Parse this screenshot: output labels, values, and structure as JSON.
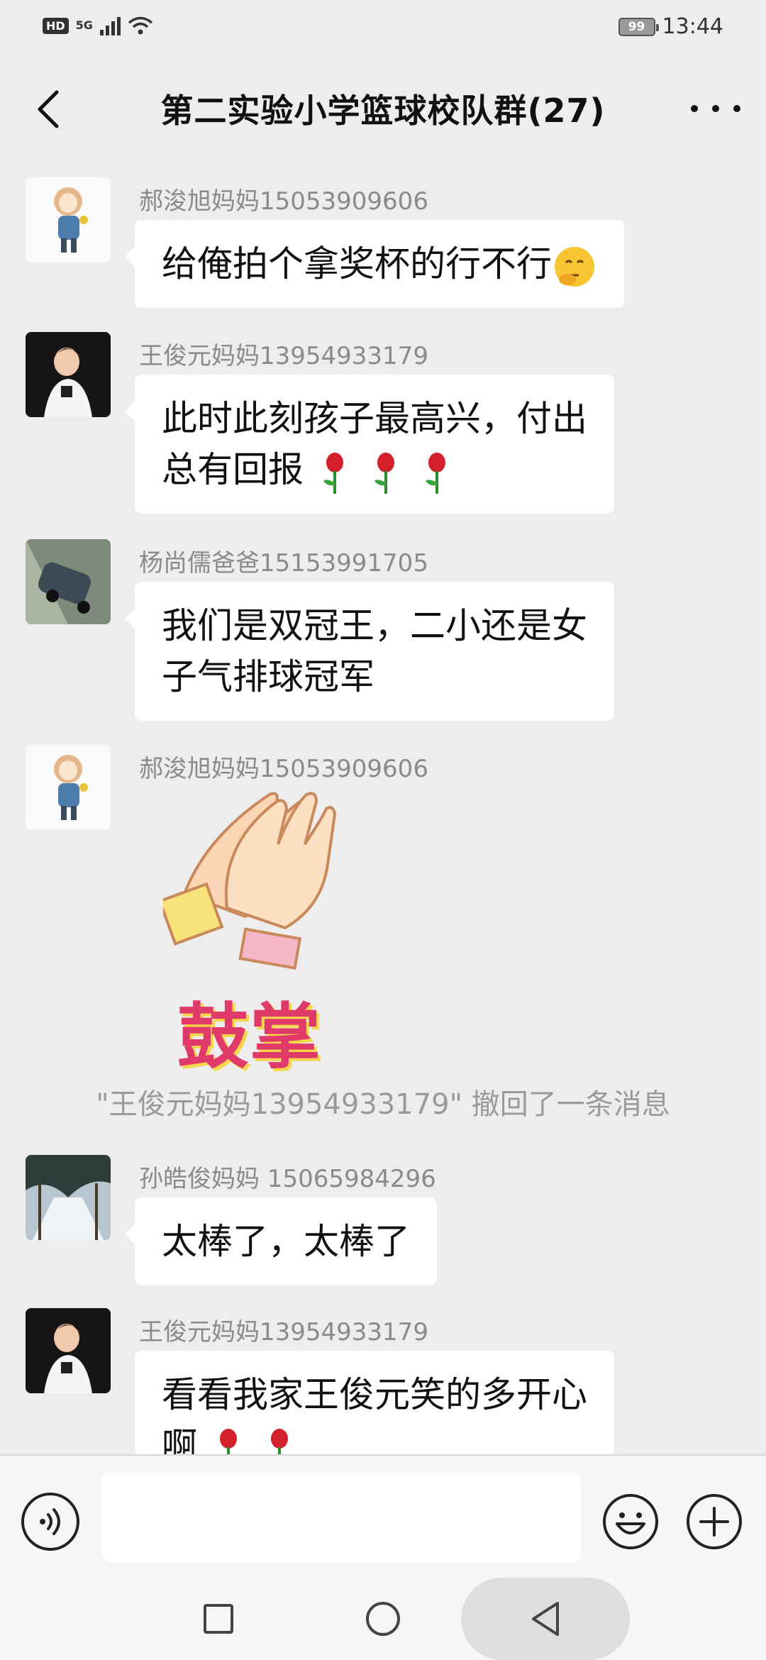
{
  "status_bar": {
    "hd": "HD",
    "network": "5G",
    "battery": "99",
    "time": "13:44"
  },
  "header": {
    "title": "第二实验小学篮球校队群(27)"
  },
  "messages": [
    {
      "sender": "郝浚旭妈妈15053909606",
      "text": "给俺拍个拿奖杯的行不行"
    },
    {
      "sender": "王俊元妈妈13954933179",
      "line1": "此时此刻孩子最高兴，付出",
      "line2": "总有回报"
    },
    {
      "sender": "杨尚儒爸爸15153991705",
      "line1": "我们是双冠王，二小还是女",
      "line2": "子气排球冠军"
    },
    {
      "sender": "郝浚旭妈妈15053909606",
      "sticker_text": "鼓掌"
    },
    {
      "sender": "孙皓俊妈妈  15065984296",
      "text": "太棒了，太棒了"
    },
    {
      "sender": "王俊元妈妈13954933179",
      "line1": "看看我家王俊元笑的多开心",
      "line2": "啊"
    }
  ],
  "system_note": "\"王俊元妈妈13954933179\" 撤回了一条消息",
  "colors": {
    "background": "#ededed",
    "bubble": "#ffffff",
    "sender": "#8a8a8a",
    "sticker_red": "#e03a6a"
  },
  "icons": [
    "back-arrow-icon",
    "more-icon",
    "voice-icon",
    "emoji-icon",
    "plus-icon",
    "rose-icon",
    "thinking-emoji-icon",
    "square-icon",
    "circle-icon",
    "triangle-back-icon"
  ]
}
